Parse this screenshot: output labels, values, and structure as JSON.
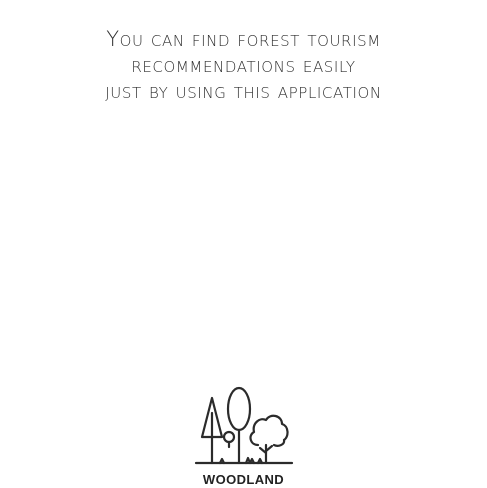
{
  "onboarding": {
    "lines": [
      "You can find forest tourism",
      "recommendations easily",
      "just by using this application"
    ]
  },
  "logo": {
    "brand": "WOODLAND",
    "icon": "forest-trees-icon",
    "stroke_color": "#2b2b2b"
  }
}
